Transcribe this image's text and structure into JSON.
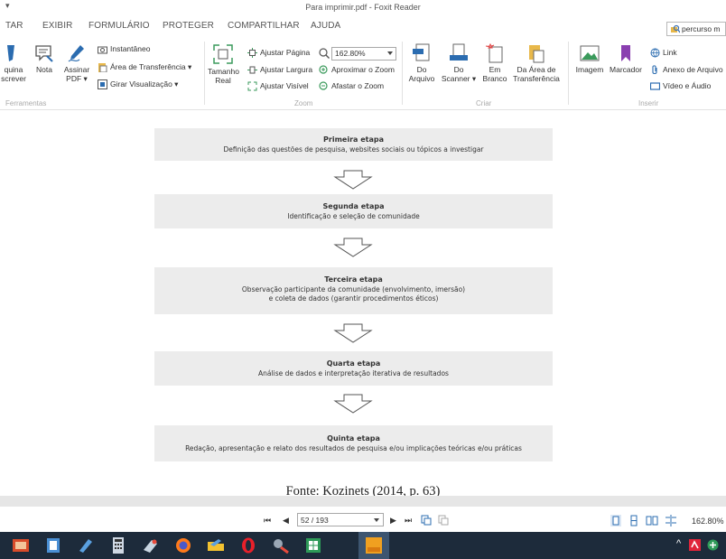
{
  "window": {
    "title": "Para imprimir.pdf - Foxit Reader",
    "quick_access": "▾"
  },
  "menu": {
    "tabs": [
      "TAR",
      "EXIBIR",
      "FORMULÁRIO",
      "PROTEGER",
      "COMPARTILHAR",
      "AJUDA"
    ],
    "search_value": "percurso m"
  },
  "ribbon": {
    "ferramentas": {
      "label": "Ferramentas",
      "maquina_escrever": [
        "quina",
        "screver"
      ],
      "nota": "Nota",
      "assinar_pdf": [
        "Assinar",
        "PDF ▾"
      ],
      "instantaneo": "Instantâneo",
      "area_transferencia": "Área de Transferência ▾",
      "girar_visualizacao": "Girar Visualização ▾"
    },
    "zoom": {
      "label": "Zoom",
      "tamanho_real": [
        "Tamanho",
        "Real"
      ],
      "ajustar_pagina": "Ajustar Página",
      "ajustar_largura": "Ajustar Largura",
      "ajustar_visivel": "Ajustar Visível",
      "zoom_value": "162.80%",
      "aproximar": "Aproximar o Zoom",
      "afastar": "Afastar o Zoom"
    },
    "criar": {
      "label": "Criar",
      "do_arquivo": [
        "Do",
        "Arquivo"
      ],
      "do_scanner": [
        "Do",
        "Scanner ▾"
      ],
      "em_branco": [
        "Em",
        "Branco"
      ],
      "da_area": [
        "Da Área de",
        "Transferência"
      ]
    },
    "inserir": {
      "label": "Inserir",
      "imagem": "Imagem",
      "marcador": "Marcador",
      "link": "Link",
      "anexo": "Anexo de Arquivo",
      "video": "Vídeo e Áudio"
    }
  },
  "document": {
    "steps": [
      {
        "title": "Primeira etapa",
        "lines": [
          "Definição das questões de pesquisa, websites sociais ou tópicos a investigar"
        ]
      },
      {
        "title": "Segunda etapa",
        "lines": [
          "Identificação e seleção de comunidade"
        ]
      },
      {
        "title": "Terceira etapa",
        "lines": [
          "Observação participante da comunidade (envolvimento, imersão)",
          "e coleta de dados (garantir procedimentos éticos)"
        ]
      },
      {
        "title": "Quarta etapa",
        "lines": [
          "Análise de dados e interpretação iterativa de resultados"
        ]
      },
      {
        "title": "Quinta etapa",
        "lines": [
          "Redação, apresentação e relato dos resultados de pesquisa e/ou implicações teóricas e/ou práticas"
        ]
      }
    ],
    "caption": "Fonte: Kozinets (2014, p. 63)"
  },
  "status": {
    "first": "⏮",
    "prev": "◀",
    "next": "▶",
    "last": "⏭",
    "page": "52 / 193",
    "zoom": "162.80%"
  },
  "colors": {
    "accent_blue": "#2b6cb0",
    "accent_green": "#3a9a5b",
    "taskbar": "#1d2b3b"
  }
}
